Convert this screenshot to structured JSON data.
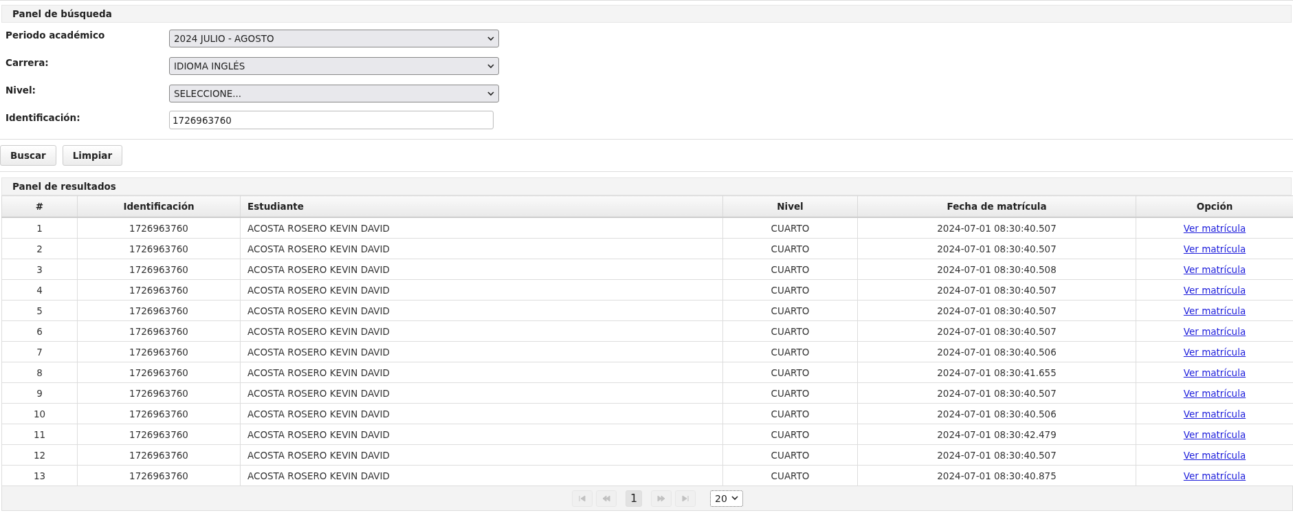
{
  "search_panel": {
    "title": "Panel de búsqueda",
    "fields": [
      {
        "label": "Periodo académico",
        "kind": "select",
        "value": "2024 JULIO - AGOSTO"
      },
      {
        "label": "Carrera:",
        "kind": "select",
        "value": "IDIOMA INGLÉS"
      },
      {
        "label": "Nivel:",
        "kind": "select",
        "value": "SELECCIONE..."
      },
      {
        "label": "Identificación:",
        "kind": "input",
        "value": "1726963760"
      }
    ],
    "buttons": [
      "Buscar",
      "Limpiar"
    ]
  },
  "results_panel": {
    "title": "Panel de resultados",
    "table": {
      "columns": [
        "#",
        "Identificación",
        "Estudiante",
        "Nivel",
        "Fecha de matrícula",
        "Opción"
      ],
      "rows": [
        [
          "1",
          "1726963760",
          "ACOSTA ROSERO KEVIN DAVID",
          "CUARTO",
          "2024-07-01 08:30:40.507",
          "Ver matrícula"
        ],
        [
          "2",
          "1726963760",
          "ACOSTA ROSERO KEVIN DAVID",
          "CUARTO",
          "2024-07-01 08:30:40.507",
          "Ver matrícula"
        ],
        [
          "3",
          "1726963760",
          "ACOSTA ROSERO KEVIN DAVID",
          "CUARTO",
          "2024-07-01 08:30:40.508",
          "Ver matrícula"
        ],
        [
          "4",
          "1726963760",
          "ACOSTA ROSERO KEVIN DAVID",
          "CUARTO",
          "2024-07-01 08:30:40.507",
          "Ver matrícula"
        ],
        [
          "5",
          "1726963760",
          "ACOSTA ROSERO KEVIN DAVID",
          "CUARTO",
          "2024-07-01 08:30:40.507",
          "Ver matrícula"
        ],
        [
          "6",
          "1726963760",
          "ACOSTA ROSERO KEVIN DAVID",
          "CUARTO",
          "2024-07-01 08:30:40.507",
          "Ver matrícula"
        ],
        [
          "7",
          "1726963760",
          "ACOSTA ROSERO KEVIN DAVID",
          "CUARTO",
          "2024-07-01 08:30:40.506",
          "Ver matrícula"
        ],
        [
          "8",
          "1726963760",
          "ACOSTA ROSERO KEVIN DAVID",
          "CUARTO",
          "2024-07-01 08:30:41.655",
          "Ver matrícula"
        ],
        [
          "9",
          "1726963760",
          "ACOSTA ROSERO KEVIN DAVID",
          "CUARTO",
          "2024-07-01 08:30:40.507",
          "Ver matrícula"
        ],
        [
          "10",
          "1726963760",
          "ACOSTA ROSERO KEVIN DAVID",
          "CUARTO",
          "2024-07-01 08:30:40.506",
          "Ver matrícula"
        ],
        [
          "11",
          "1726963760",
          "ACOSTA ROSERO KEVIN DAVID",
          "CUARTO",
          "2024-07-01 08:30:42.479",
          "Ver matrícula"
        ],
        [
          "12",
          "1726963760",
          "ACOSTA ROSERO KEVIN DAVID",
          "CUARTO",
          "2024-07-01 08:30:40.507",
          "Ver matrícula"
        ],
        [
          "13",
          "1726963760",
          "ACOSTA ROSERO KEVIN DAVID",
          "CUARTO",
          "2024-07-01 08:30:40.875",
          "Ver matrícula"
        ]
      ]
    },
    "pager": {
      "buttons": [
        {
          "kind": "first",
          "disabled": true
        },
        {
          "kind": "prev",
          "disabled": true
        },
        {
          "kind": "page",
          "label": "1",
          "selected": true
        },
        {
          "kind": "next",
          "disabled": true
        },
        {
          "kind": "last",
          "disabled": true
        }
      ],
      "page_size": "20"
    }
  }
}
